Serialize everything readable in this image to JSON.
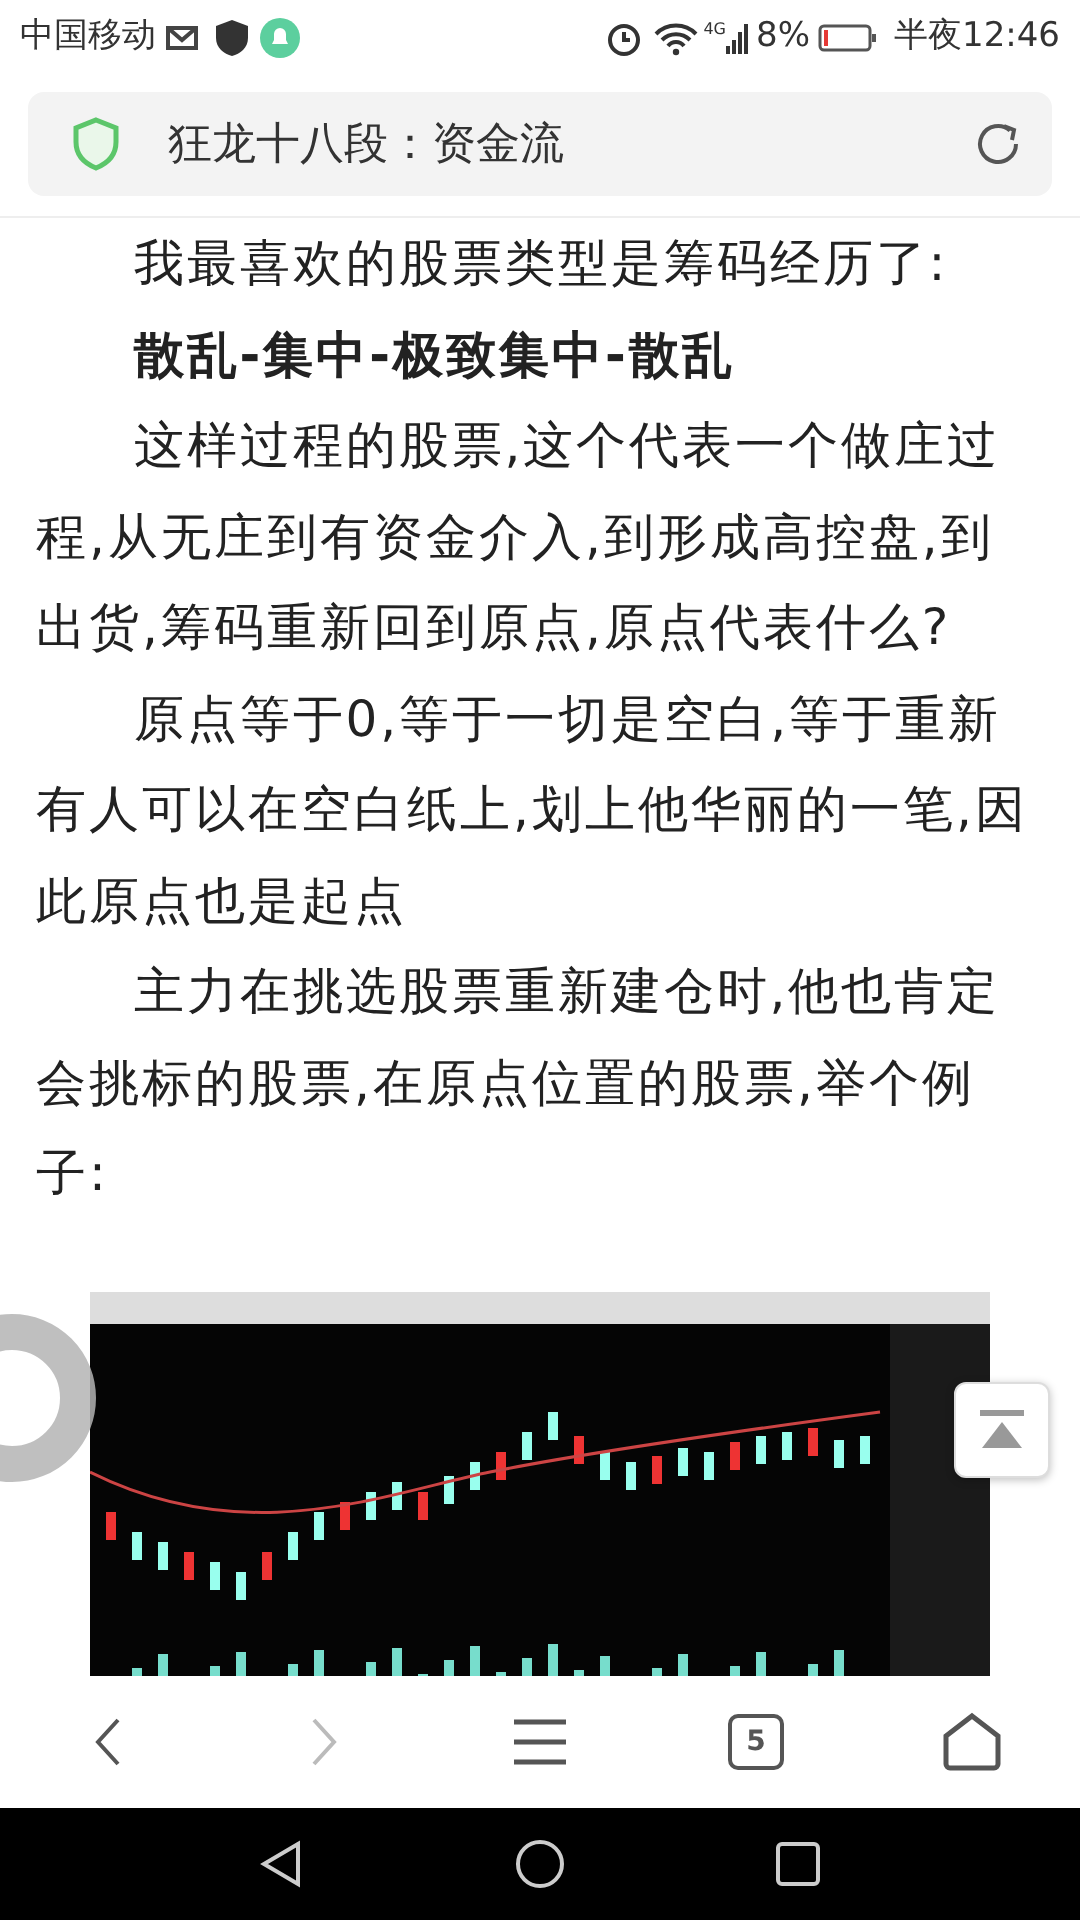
{
  "status_bar": {
    "carrier": "中国移动",
    "network": "4G",
    "battery_text": "8%",
    "time": "半夜12:46"
  },
  "address_bar": {
    "title": "狂龙十八段：资金流"
  },
  "article": {
    "paragraphs": [
      {
        "text": "我最喜欢的股票类型是筹码经历了:",
        "bold": false
      },
      {
        "text": "散乱-集中-极致集中-散乱",
        "bold": true
      },
      {
        "text": "这样过程的股票,这个代表一个做庄过程,从无庄到有资金介入,到形成高控盘,到出货,筹码重新回到原点,原点代表什么?",
        "bold": false
      },
      {
        "text": "原点等于0,等于一切是空白,等于重新有人可以在空白纸上,划上他华丽的一笔,因此原点也是起点",
        "bold": false
      },
      {
        "text": "主力在挑选股票重新建仓时,他也肯定会挑标的股票,在原点位置的股票,举个例子:",
        "bold": false
      }
    ]
  },
  "toolbar": {
    "items": [
      {
        "kind": "back",
        "disabled": false
      },
      {
        "kind": "forward",
        "disabled": true
      },
      {
        "kind": "menu",
        "disabled": false
      },
      {
        "kind": "tabs",
        "label": "5",
        "disabled": false
      },
      {
        "kind": "home",
        "disabled": false
      }
    ]
  }
}
